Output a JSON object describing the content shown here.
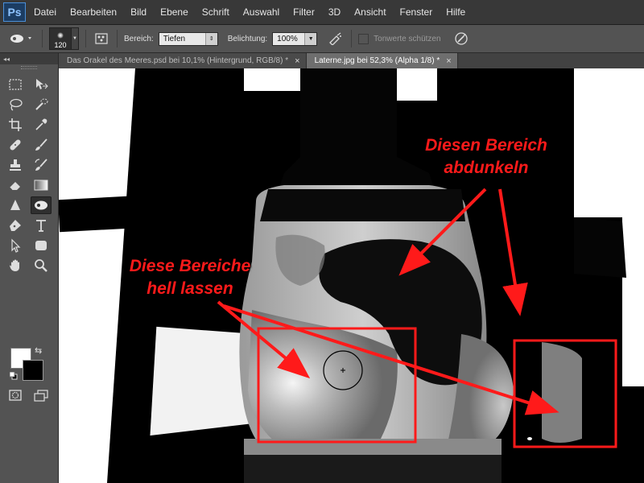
{
  "app": {
    "logo": "Ps"
  },
  "menu": [
    "Datei",
    "Bearbeiten",
    "Bild",
    "Ebene",
    "Schrift",
    "Auswahl",
    "Filter",
    "3D",
    "Ansicht",
    "Fenster",
    "Hilfe"
  ],
  "options": {
    "brush_size": "120",
    "range_label": "Bereich:",
    "range_value": "Tiefen",
    "exposure_label": "Belichtung:",
    "exposure_value": "100%",
    "protect_tones_label": "Tonwerte schützen"
  },
  "tabs": [
    {
      "label": "Das Orakel des Meeres.psd bei 10,1% (Hintergrund, RGB/8) *",
      "close": "×",
      "active": false
    },
    {
      "label": "Laterne.jpg bei 52,3% (Alpha 1/8) *",
      "close": "×",
      "active": true
    }
  ],
  "toolbar": {
    "collapse": "◂◂"
  },
  "annotations": {
    "darken_line1": "Diesen Bereich",
    "darken_line2": "abdunkeln",
    "light_line1": "Diese Bereiche",
    "light_line2": "hell lassen"
  },
  "colors": {
    "annotation": "#ff1a1a",
    "foreground": "#ffffff",
    "background": "#000000"
  }
}
